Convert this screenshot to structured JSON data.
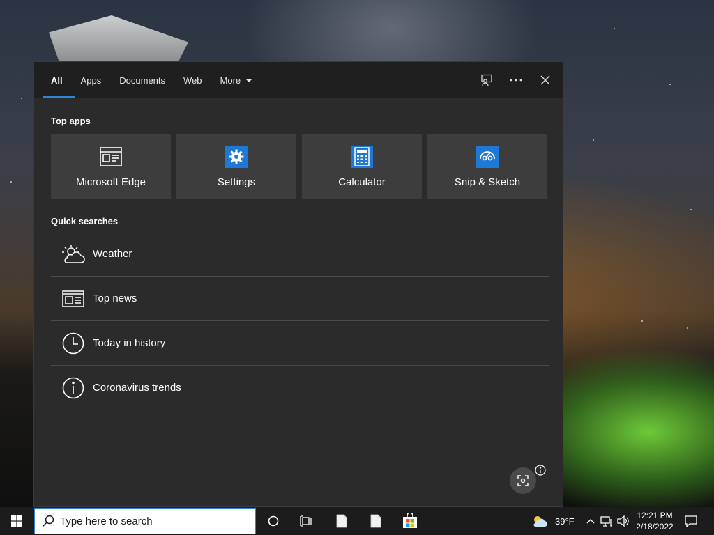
{
  "search_panel": {
    "tabs": [
      {
        "label": "All"
      },
      {
        "label": "Apps"
      },
      {
        "label": "Documents"
      },
      {
        "label": "Web"
      },
      {
        "label": "More"
      }
    ],
    "tools": {
      "feedback_icon": "feedback-icon",
      "more_options_icon": "ellipsis-icon",
      "close_icon": "close-icon"
    },
    "top_apps_heading": "Top apps",
    "top_apps": [
      {
        "label": "Microsoft Edge",
        "icon": "edge-icon"
      },
      {
        "label": "Settings",
        "icon": "settings-gear-icon"
      },
      {
        "label": "Calculator",
        "icon": "calculator-icon"
      },
      {
        "label": "Snip & Sketch",
        "icon": "snip-sketch-icon"
      }
    ],
    "quick_searches_heading": "Quick searches",
    "quick_searches": [
      {
        "label": "Weather",
        "icon": "weather-icon"
      },
      {
        "label": "Top news",
        "icon": "news-icon"
      },
      {
        "label": "Today in history",
        "icon": "clock-icon"
      },
      {
        "label": "Coronavirus trends",
        "icon": "info-icon"
      }
    ]
  },
  "taskbar": {
    "search_placeholder": "Type here to search",
    "weather_temp": "39°F",
    "time": "12:21 PM",
    "date": "2/18/2022"
  },
  "colors": {
    "accent": "#2f86d8",
    "app_tile_blue": "#1e78d6",
    "panel_bg": "#2b2b2b",
    "tabbar_bg": "#1f1f1f"
  }
}
